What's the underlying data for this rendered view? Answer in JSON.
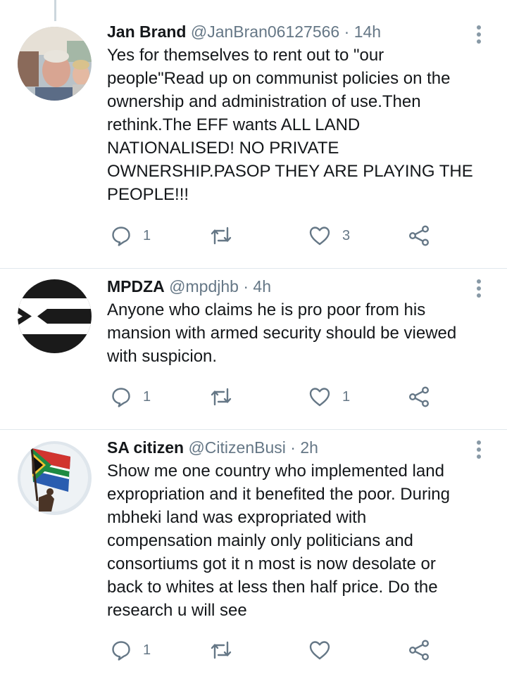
{
  "tweets": [
    {
      "name": "Jan Brand",
      "handle": "@JanBran06127566",
      "separator": "·",
      "time": "14h",
      "lines": [
        "Yes for themselves to rent out to \"our",
        "people\"Read up on communist policies on the",
        "ownership and administration of use.Then",
        "rethink.The EFF wants ALL LAND",
        "NATIONALISED! NO PRIVATE",
        "OWNERSHIP.PASOP THEY ARE PLAYING THE",
        "PEOPLE!!!"
      ],
      "reply_count": "1",
      "retweet_count": "",
      "like_count": "3",
      "avatar_icon": "profile-photo"
    },
    {
      "name": "MPDZA",
      "handle": "@mpdjhb",
      "separator": "·",
      "time": "4h",
      "lines": [
        "Anyone who claims he is pro poor from his",
        "mansion with armed security should be viewed",
        "with suspicion."
      ],
      "reply_count": "1",
      "retweet_count": "",
      "like_count": "1",
      "avatar_icon": "flag-logo"
    },
    {
      "name": "SA citizen",
      "handle": "@CitizenBusi",
      "separator": "·",
      "time": "2h",
      "lines": [
        "Show me one country who implemented land",
        "expropriation and it benefited the poor. During",
        "mbheki land was expropriated with",
        "compensation mainly only politicians and",
        "consortiums got it n most is now desolate or",
        "back to whites at less then half price. Do the",
        "research u will see"
      ],
      "reply_count": "1",
      "retweet_count": "",
      "like_count": "",
      "avatar_icon": "flag-photo"
    }
  ],
  "colors": {
    "text": "#14171a",
    "secondary": "#657786",
    "divider": "#e1e8ed",
    "icon": "#657786"
  }
}
